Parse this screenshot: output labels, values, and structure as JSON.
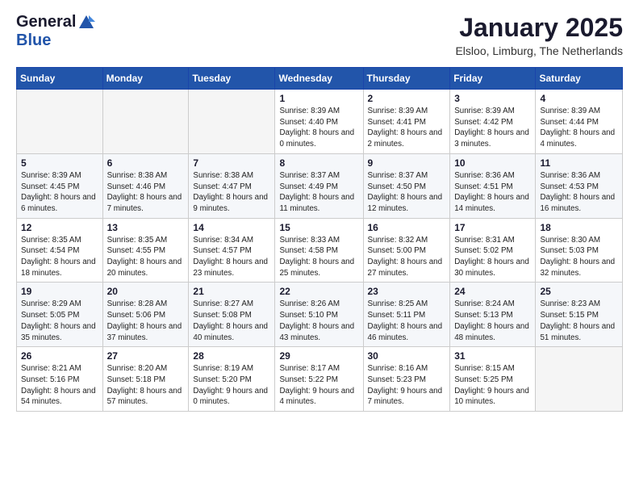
{
  "logo": {
    "general": "General",
    "blue": "Blue"
  },
  "title": "January 2025",
  "location": "Elsloo, Limburg, The Netherlands",
  "days_of_week": [
    "Sunday",
    "Monday",
    "Tuesday",
    "Wednesday",
    "Thursday",
    "Friday",
    "Saturday"
  ],
  "weeks": [
    [
      {
        "day": "",
        "content": ""
      },
      {
        "day": "",
        "content": ""
      },
      {
        "day": "",
        "content": ""
      },
      {
        "day": "1",
        "content": "Sunrise: 8:39 AM\nSunset: 4:40 PM\nDaylight: 8 hours and 0 minutes."
      },
      {
        "day": "2",
        "content": "Sunrise: 8:39 AM\nSunset: 4:41 PM\nDaylight: 8 hours and 2 minutes."
      },
      {
        "day": "3",
        "content": "Sunrise: 8:39 AM\nSunset: 4:42 PM\nDaylight: 8 hours and 3 minutes."
      },
      {
        "day": "4",
        "content": "Sunrise: 8:39 AM\nSunset: 4:44 PM\nDaylight: 8 hours and 4 minutes."
      }
    ],
    [
      {
        "day": "5",
        "content": "Sunrise: 8:39 AM\nSunset: 4:45 PM\nDaylight: 8 hours and 6 minutes."
      },
      {
        "day": "6",
        "content": "Sunrise: 8:38 AM\nSunset: 4:46 PM\nDaylight: 8 hours and 7 minutes."
      },
      {
        "day": "7",
        "content": "Sunrise: 8:38 AM\nSunset: 4:47 PM\nDaylight: 8 hours and 9 minutes."
      },
      {
        "day": "8",
        "content": "Sunrise: 8:37 AM\nSunset: 4:49 PM\nDaylight: 8 hours and 11 minutes."
      },
      {
        "day": "9",
        "content": "Sunrise: 8:37 AM\nSunset: 4:50 PM\nDaylight: 8 hours and 12 minutes."
      },
      {
        "day": "10",
        "content": "Sunrise: 8:36 AM\nSunset: 4:51 PM\nDaylight: 8 hours and 14 minutes."
      },
      {
        "day": "11",
        "content": "Sunrise: 8:36 AM\nSunset: 4:53 PM\nDaylight: 8 hours and 16 minutes."
      }
    ],
    [
      {
        "day": "12",
        "content": "Sunrise: 8:35 AM\nSunset: 4:54 PM\nDaylight: 8 hours and 18 minutes."
      },
      {
        "day": "13",
        "content": "Sunrise: 8:35 AM\nSunset: 4:55 PM\nDaylight: 8 hours and 20 minutes."
      },
      {
        "day": "14",
        "content": "Sunrise: 8:34 AM\nSunset: 4:57 PM\nDaylight: 8 hours and 23 minutes."
      },
      {
        "day": "15",
        "content": "Sunrise: 8:33 AM\nSunset: 4:58 PM\nDaylight: 8 hours and 25 minutes."
      },
      {
        "day": "16",
        "content": "Sunrise: 8:32 AM\nSunset: 5:00 PM\nDaylight: 8 hours and 27 minutes."
      },
      {
        "day": "17",
        "content": "Sunrise: 8:31 AM\nSunset: 5:02 PM\nDaylight: 8 hours and 30 minutes."
      },
      {
        "day": "18",
        "content": "Sunrise: 8:30 AM\nSunset: 5:03 PM\nDaylight: 8 hours and 32 minutes."
      }
    ],
    [
      {
        "day": "19",
        "content": "Sunrise: 8:29 AM\nSunset: 5:05 PM\nDaylight: 8 hours and 35 minutes."
      },
      {
        "day": "20",
        "content": "Sunrise: 8:28 AM\nSunset: 5:06 PM\nDaylight: 8 hours and 37 minutes."
      },
      {
        "day": "21",
        "content": "Sunrise: 8:27 AM\nSunset: 5:08 PM\nDaylight: 8 hours and 40 minutes."
      },
      {
        "day": "22",
        "content": "Sunrise: 8:26 AM\nSunset: 5:10 PM\nDaylight: 8 hours and 43 minutes."
      },
      {
        "day": "23",
        "content": "Sunrise: 8:25 AM\nSunset: 5:11 PM\nDaylight: 8 hours and 46 minutes."
      },
      {
        "day": "24",
        "content": "Sunrise: 8:24 AM\nSunset: 5:13 PM\nDaylight: 8 hours and 48 minutes."
      },
      {
        "day": "25",
        "content": "Sunrise: 8:23 AM\nSunset: 5:15 PM\nDaylight: 8 hours and 51 minutes."
      }
    ],
    [
      {
        "day": "26",
        "content": "Sunrise: 8:21 AM\nSunset: 5:16 PM\nDaylight: 8 hours and 54 minutes."
      },
      {
        "day": "27",
        "content": "Sunrise: 8:20 AM\nSunset: 5:18 PM\nDaylight: 8 hours and 57 minutes."
      },
      {
        "day": "28",
        "content": "Sunrise: 8:19 AM\nSunset: 5:20 PM\nDaylight: 9 hours and 0 minutes."
      },
      {
        "day": "29",
        "content": "Sunrise: 8:17 AM\nSunset: 5:22 PM\nDaylight: 9 hours and 4 minutes."
      },
      {
        "day": "30",
        "content": "Sunrise: 8:16 AM\nSunset: 5:23 PM\nDaylight: 9 hours and 7 minutes."
      },
      {
        "day": "31",
        "content": "Sunrise: 8:15 AM\nSunset: 5:25 PM\nDaylight: 9 hours and 10 minutes."
      },
      {
        "day": "",
        "content": ""
      }
    ]
  ]
}
